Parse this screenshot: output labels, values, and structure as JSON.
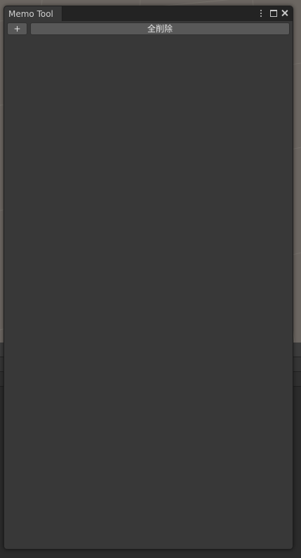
{
  "window": {
    "tab_title": "Memo Tool",
    "controls": {
      "menu_icon": "vertical-ellipsis",
      "maximize_icon": "maximize-window",
      "close_icon": "close-x"
    }
  },
  "toolbar": {
    "add_label": "+",
    "delete_all_label": "全削除"
  },
  "colors": {
    "window_bg": "#383838",
    "titlebar_bg": "#232323",
    "button_bg": "#585858",
    "text": "#cfcfcf",
    "backdrop": "#6b6661"
  }
}
